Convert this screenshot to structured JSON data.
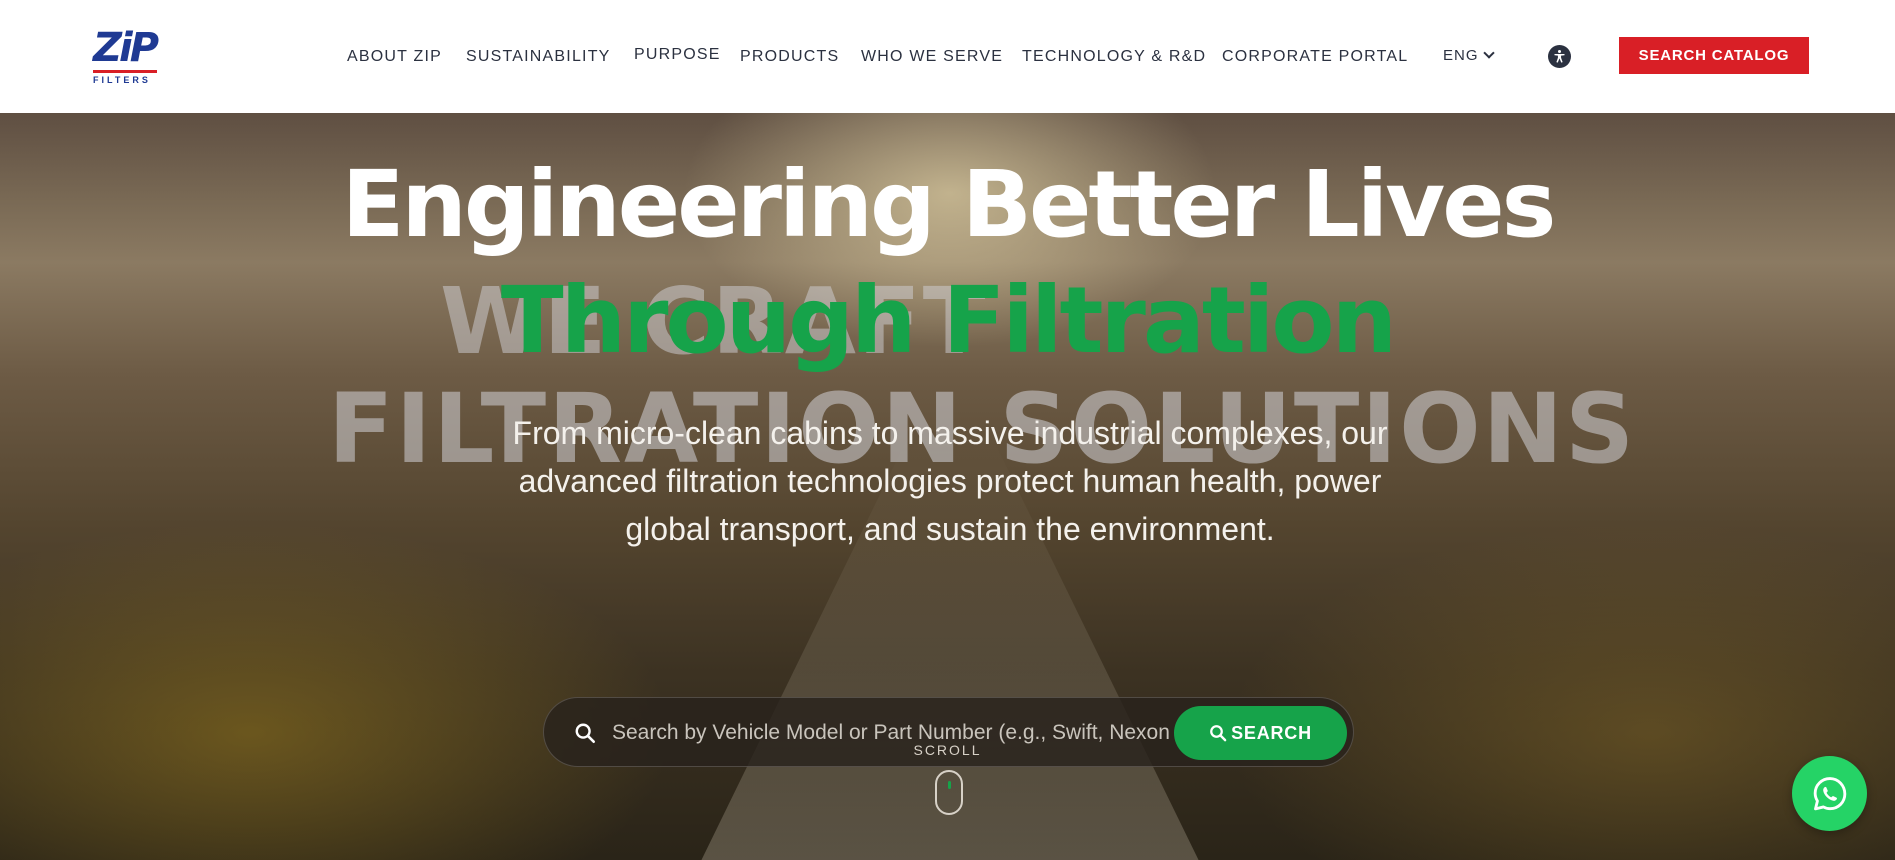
{
  "brand": {
    "logo_text": "ZiP",
    "logo_sub": "FILTERS",
    "brand_blue": "#1f3a93",
    "brand_red": "#d91f26"
  },
  "nav": {
    "items": [
      {
        "label": "ABOUT ZIP"
      },
      {
        "label": "SUSTAINABILITY"
      },
      {
        "label": "PURPOSE"
      },
      {
        "label": "PRODUCTS"
      },
      {
        "label": "WHO WE SERVE"
      },
      {
        "label": "TECHNOLOGY & R&D"
      },
      {
        "label": "CORPORATE PORTAL"
      }
    ],
    "language": "ENG",
    "accessibility_icon": "accessibility-icon",
    "cta_label": "SEARCH CATALOG"
  },
  "hero": {
    "headline_line1": "Engineering Better Lives",
    "headline_line2": "Through Filtration",
    "background_text_line1": "WE CRAFT",
    "background_text_line2": "FILTRATION SOLUTIONS",
    "lead": "From micro-clean cabins to massive industrial complexes, our advanced filtration technologies protect human health, power global transport, and sustain the environment.",
    "accent_green": "#16a34a"
  },
  "search": {
    "placeholder": "Search by Vehicle Model or Part Number (e.g., Swift, Nexon",
    "button_label": "SEARCH",
    "icon": "search-icon"
  },
  "scroll": {
    "label": "SCROLL"
  },
  "whatsapp": {
    "icon": "whatsapp-icon",
    "color": "#25d366"
  }
}
